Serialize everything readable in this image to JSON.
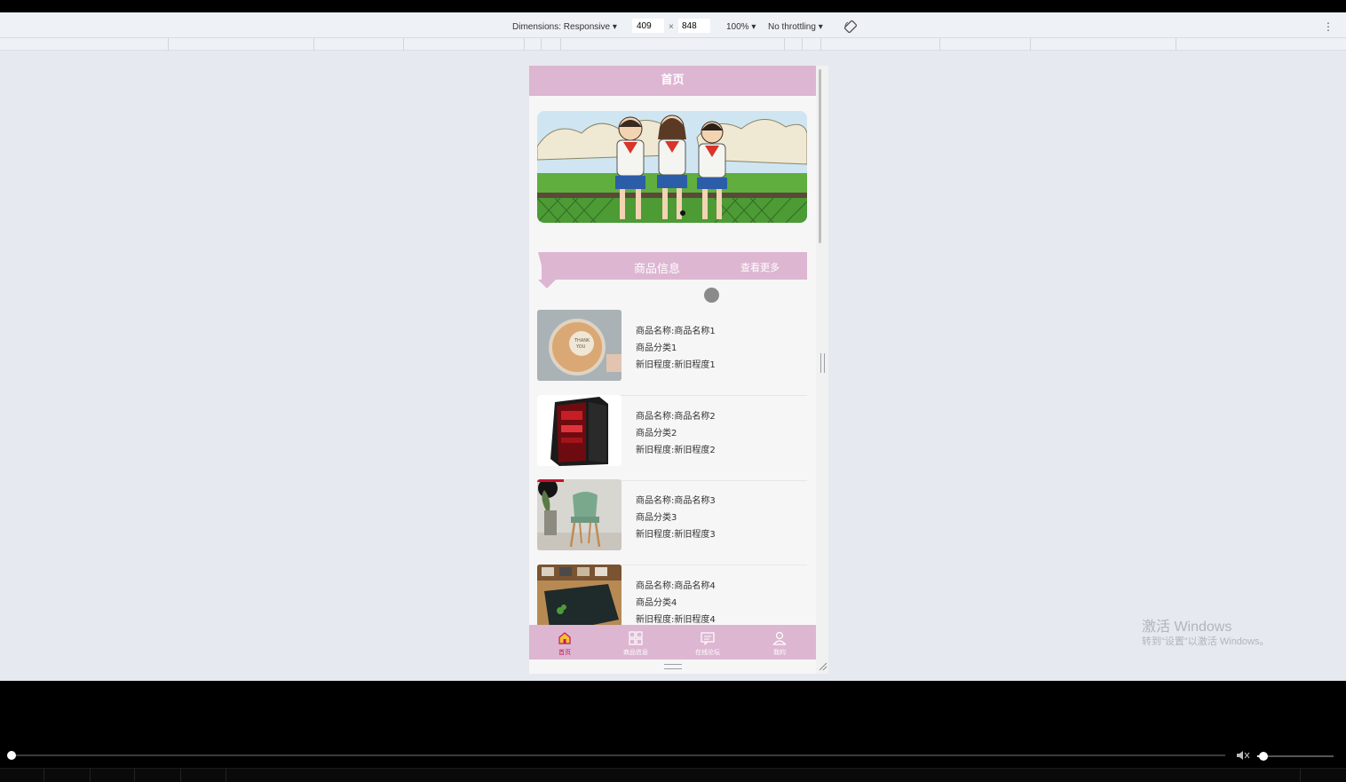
{
  "devtools": {
    "dimensions_label": "Dimensions: Responsive ▾",
    "width_value": "409",
    "times": "×",
    "height_value": "848",
    "zoom_label": "100% ▾",
    "throttling_label": "No throttling ▾"
  },
  "app": {
    "header_title": "首页",
    "section_title": "商品信息",
    "section_more": "查看更多",
    "accent_color": "#ddb6d2",
    "items": [
      {
        "name": "商品名称:商品名称1",
        "category": "商品分类1",
        "condition": "新旧程度:新旧程度1"
      },
      {
        "name": "商品名称:商品名称2",
        "category": "商品分类2",
        "condition": "新旧程度:新旧程度2"
      },
      {
        "name": "商品名称:商品名称3",
        "category": "商品分类3",
        "condition": "新旧程度:新旧程度3"
      },
      {
        "name": "商品名称:商品名称4",
        "category": "商品分类4",
        "condition": "新旧程度:新旧程度4"
      }
    ],
    "tabs": [
      {
        "label": "首页",
        "icon": "home-icon",
        "active": true
      },
      {
        "label": "商品信息",
        "icon": "grid-icon",
        "active": false
      },
      {
        "label": "在线论坛",
        "icon": "forum-icon",
        "active": false
      },
      {
        "label": "我的",
        "icon": "user-icon",
        "active": false
      }
    ]
  },
  "watermark": {
    "line1": "激活 Windows",
    "line2": "转到\"设置\"以激活 Windows。"
  }
}
